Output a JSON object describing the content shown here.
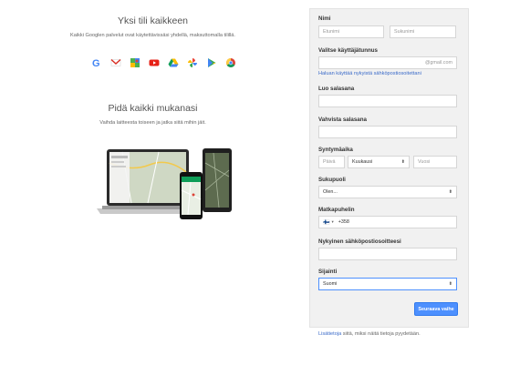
{
  "left": {
    "title1": "Yksi tili kaikkeen",
    "subtitle1": "Kaikki Googlen palvelut ovat käytettävissäsi yhdellä, maksuttomalla tilillä.",
    "icons": [
      "google-g-icon",
      "gmail-icon",
      "maps-icon",
      "youtube-icon",
      "drive-icon",
      "photos-icon",
      "play-store-icon",
      "chrome-icon"
    ],
    "title2": "Pidä kaikki mukanasi",
    "subtitle2": "Vaihda laitteesta toiseen ja jatka siitä mihin jäit."
  },
  "form": {
    "name_label": "Nimi",
    "first_name_placeholder": "Etunimi",
    "last_name_placeholder": "Sukunimi",
    "username_label": "Valitse käyttäjätunnus",
    "username_suffix": "@gmail.com",
    "use_existing_link": "Haluan käyttää nykyistä sähköpostiosoitettani",
    "password_label": "Luo salasana",
    "confirm_label": "Vahvista salasana",
    "birthday_label": "Syntymäaika",
    "day_placeholder": "Päivä",
    "month_value": "Kuukausi",
    "year_placeholder": "Vuosi",
    "gender_label": "Sukupuoli",
    "gender_value": "Olen...",
    "phone_label": "Matkapuhelin",
    "phone_flag": "🇫🇮",
    "phone_prefix": "+358",
    "current_email_label": "Nykyinen sähköpostiosoitteesi",
    "location_label": "Sijainti",
    "location_value": "Suomi",
    "next_button": "Seuraava vaihe",
    "footer_link": "Lisätietoja",
    "footer_text": " siitä, miksi näitä tietoja pyydetään."
  }
}
